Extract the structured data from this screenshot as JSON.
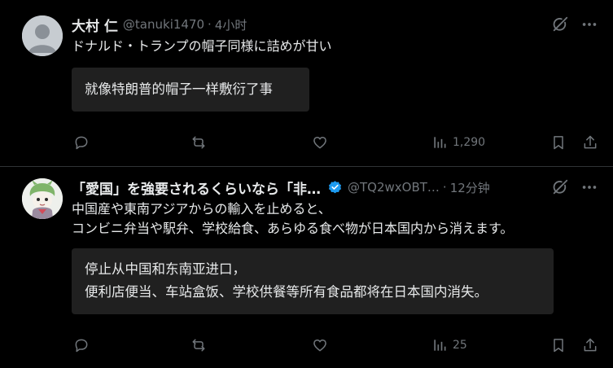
{
  "tweets": [
    {
      "display_name": "大村 仁",
      "handle": "@tanuki1470",
      "separator": "·",
      "time": "4小时",
      "text_lines": [
        "ドナルド・トランプの帽子同様に詰めが甘い"
      ],
      "translation_lines": [
        "就像特朗普的帽子一样敷衍了事"
      ],
      "views": "1,290",
      "verified": false,
      "avatar": "default-avatar-icon"
    },
    {
      "display_name": "「愛国」を強要されるくらいなら「非…",
      "handle": "@TQ2wxOBT…",
      "separator": "·",
      "time": "12分钟",
      "text_lines": [
        "中国産や東南アジアからの輸入を止めると、",
        "コンビニ弁当や駅弁、学校給食、あらゆる食べ物が日本国内から消えます。"
      ],
      "translation_lines": [
        "停止从中国和东南亚进口，",
        "便利店便当、车站盒饭、学校供餐等所有食品都将在日本国内消失。"
      ],
      "views": "25",
      "verified": true,
      "avatar": "anime-character-avatar"
    }
  ],
  "colors": {
    "background": "#000000",
    "text": "#e7e9ea",
    "secondary": "#71767b",
    "translation_box": "#202020",
    "verified": "#1d9bf0",
    "divider": "#2f3336"
  },
  "icons": [
    "grok-icon",
    "more-icon",
    "reply-icon",
    "retweet-icon",
    "like-icon",
    "views-icon",
    "bookmark-icon",
    "share-icon",
    "verified-badge-icon"
  ]
}
